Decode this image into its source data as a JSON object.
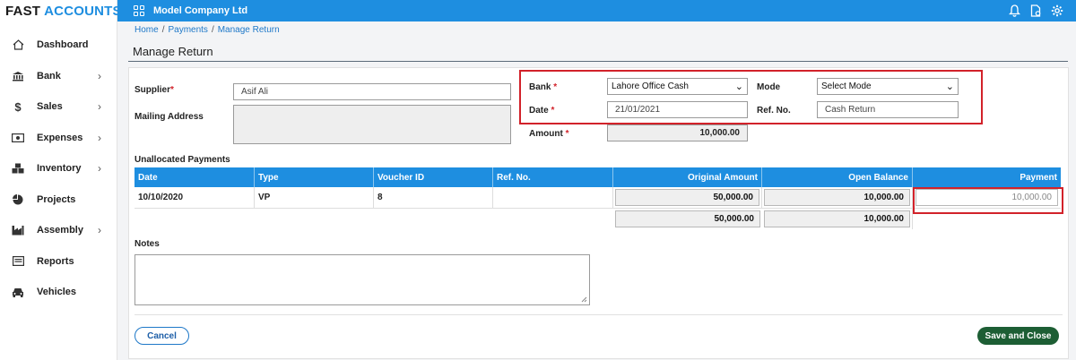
{
  "brand": {
    "part1": "FAST",
    "part2": "ACCOUNTS"
  },
  "sidebar": {
    "items": [
      {
        "label": "Dashboard",
        "icon": "home-icon",
        "has_chevron": false
      },
      {
        "label": "Bank",
        "icon": "bank-icon",
        "has_chevron": true
      },
      {
        "label": "Sales",
        "icon": "dollar-icon",
        "has_chevron": true
      },
      {
        "label": "Expenses",
        "icon": "money-bill-icon",
        "has_chevron": true
      },
      {
        "label": "Inventory",
        "icon": "cubes-icon",
        "has_chevron": true
      },
      {
        "label": "Projects",
        "icon": "pie-chart-icon",
        "has_chevron": false
      },
      {
        "label": "Assembly",
        "icon": "factory-icon",
        "has_chevron": true
      },
      {
        "label": "Reports",
        "icon": "report-icon",
        "has_chevron": false
      },
      {
        "label": "Vehicles",
        "icon": "car-icon",
        "has_chevron": false
      }
    ]
  },
  "topbar": {
    "company": "Model Company Ltd",
    "bg_color": "#1e8ee0"
  },
  "breadcrumb": {
    "home": "Home",
    "payments": "Payments",
    "current": "Manage Return"
  },
  "page_title": "Manage Return",
  "form": {
    "supplier_label": "Supplier",
    "supplier_value": "Asif Ali",
    "mailing_label": "Mailing Address",
    "bank_label": "Bank",
    "bank_value": "Lahore Office Cash",
    "mode_label": "Mode",
    "mode_value": "Select Mode",
    "date_label": "Date",
    "date_value": "21/01/2021",
    "refno_label": "Ref. No.",
    "refno_value": "Cash Return",
    "amount_label": "Amount",
    "amount_value": "10,000.00",
    "required_mark": "*"
  },
  "unallocated": {
    "title": "Unallocated Payments",
    "columns": [
      "Date",
      "Type",
      "Voucher ID",
      "Ref. No.",
      "Original Amount",
      "Open Balance",
      "Payment"
    ],
    "row": {
      "date": "10/10/2020",
      "type": "VP",
      "voucher_id": "8",
      "ref_no": "",
      "original_amount": "50,000.00",
      "open_balance": "10,000.00",
      "payment": "10,000.00"
    },
    "totals": {
      "original_amount": "50,000.00",
      "open_balance": "10,000.00"
    }
  },
  "notes_label": "Notes",
  "buttons": {
    "cancel": "Cancel",
    "save": "Save and Close"
  },
  "colors": {
    "accent": "#1e8ee0",
    "required": "#d2222a",
    "highlight": "#d2222a",
    "save": "#1d5e34"
  }
}
